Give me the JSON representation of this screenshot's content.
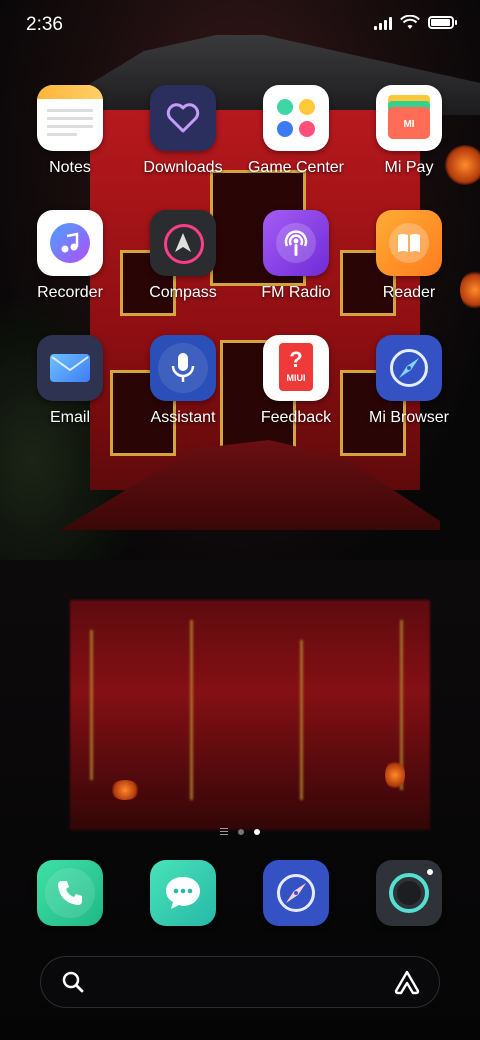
{
  "status_bar": {
    "time": "2:36"
  },
  "apps": [
    {
      "label": "Notes"
    },
    {
      "label": "Downloads"
    },
    {
      "label": "Game Center"
    },
    {
      "label": "Mi Pay"
    },
    {
      "label": "Recorder"
    },
    {
      "label": "Compass"
    },
    {
      "label": "FM Radio"
    },
    {
      "label": "Reader"
    },
    {
      "label": "Email"
    },
    {
      "label": "Assistant"
    },
    {
      "label": "Feedback"
    },
    {
      "label": "Mi Browser"
    }
  ],
  "feedback_icon_text": "MIUI",
  "mipay_icon_text": "MI",
  "pager": {
    "pages": 2,
    "current": 2
  },
  "dock": [
    {
      "icon": "phone-icon"
    },
    {
      "icon": "messages-icon"
    },
    {
      "icon": "browser-icon"
    },
    {
      "icon": "camera-icon"
    }
  ],
  "colors": {
    "downloads": "#2a2f5e",
    "game_center": "#ffffff",
    "fm_radio": "#8b42e8",
    "reader": "#ff9326",
    "email": "#2e3352",
    "assistant": "#2a4fb8",
    "browser": "#3452c4",
    "phone": "#33d49a",
    "messages": "#3ad6b0",
    "camera": "#2f3238"
  }
}
